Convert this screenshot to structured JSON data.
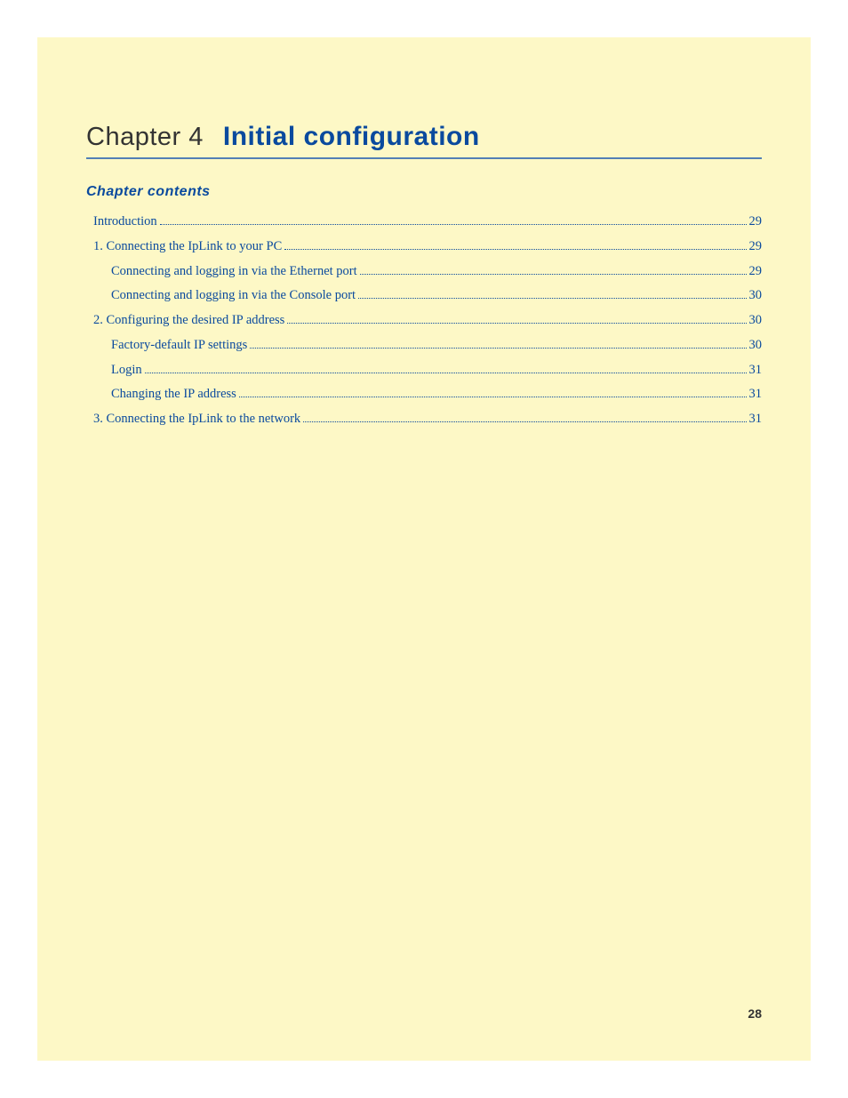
{
  "chapter": {
    "label": "Chapter 4",
    "title": "Initial configuration",
    "contents_heading": "Chapter contents"
  },
  "toc": [
    {
      "text": "Introduction",
      "page": "29",
      "indent": 0
    },
    {
      "text": "1. Connecting the IpLink to your PC",
      "page": "29",
      "indent": 0
    },
    {
      "text": "Connecting and logging in via the Ethernet port ",
      "page": "29",
      "indent": 1
    },
    {
      "text": "Connecting and logging in via the Console port ",
      "page": "30",
      "indent": 1
    },
    {
      "text": "2. Configuring the desired IP address ",
      "page": "30",
      "indent": 0
    },
    {
      "text": "Factory-default IP settings ",
      "page": "30",
      "indent": 1
    },
    {
      "text": "Login ",
      "page": "31",
      "indent": 1
    },
    {
      "text": "Changing the IP address ",
      "page": "31",
      "indent": 1
    },
    {
      "text": "3. Connecting the IpLink to the network ",
      "page": "31",
      "indent": 0
    }
  ],
  "page_number": "28"
}
